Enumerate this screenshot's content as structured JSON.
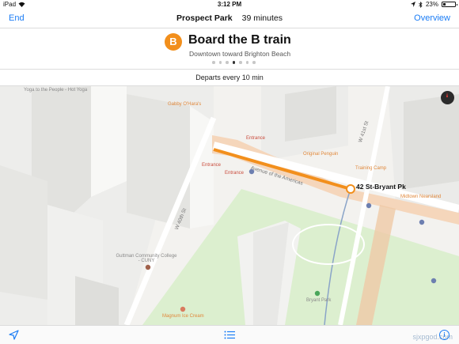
{
  "status_bar": {
    "device": "iPad",
    "time": "3:12 PM",
    "battery": "23%",
    "battery_level": 0.23
  },
  "nav": {
    "back_label": "End",
    "destination": "Prospect Park",
    "duration": "39 minutes",
    "overview_label": "Overview"
  },
  "step": {
    "line": "B",
    "line_color": "#f28f1c",
    "title": "Board the B train",
    "subtitle": "Downtown toward Brighton Beach",
    "page_count": 7,
    "current_page": 4
  },
  "departs": "Departs every 10 min",
  "map": {
    "station_label": "42 St-Bryant Pk",
    "streets": {
      "avenue": "Avenue of the Americas",
      "w40": "W 40th St",
      "w41": "W 41st St"
    },
    "pois": {
      "yoga": "Yoga to the People - Hot Yoga",
      "gabby": "Gabby O'Hara's",
      "entrance1": "Entrance",
      "entrance2": "Entrance",
      "entrance3": "Entrance",
      "penguin": "Original Penguin",
      "training": "Training Camp",
      "nearsland": "Midtown Nearsland",
      "guttman": "Guttman Community College - CUNY",
      "bryant": "Bryant Park",
      "magnum": "Magnum Ice Cream"
    }
  },
  "toolbar": {
    "location_icon": "location-arrow-icon",
    "list_icon": "list-icon",
    "info_icon": "info-icon",
    "info_glyph": "i"
  },
  "watermark": "sjxpgod.com"
}
